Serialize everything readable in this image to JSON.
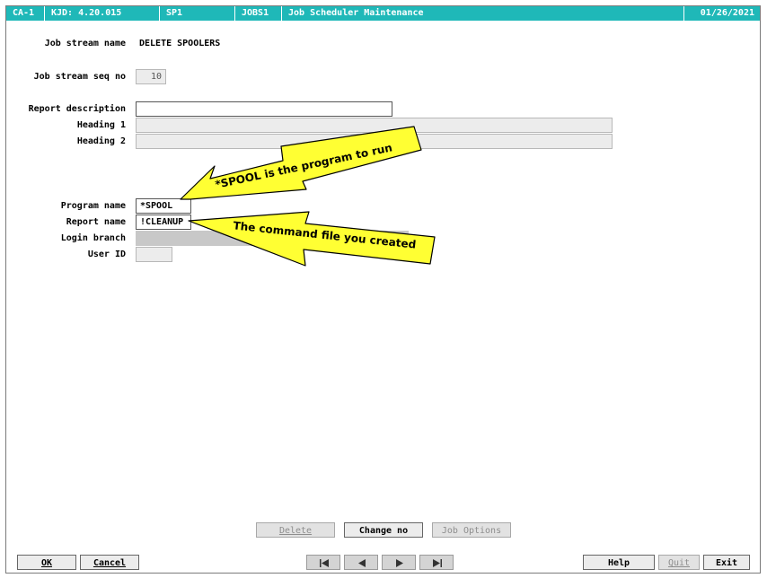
{
  "titlebar": {
    "segments": [
      "CA-1",
      "KJD: 4.20.015",
      "SP1",
      "JOBS1",
      "Job Scheduler Maintenance"
    ],
    "date": "01/26/2021"
  },
  "form": {
    "job_stream_name_label": "Job stream name",
    "job_stream_name_value": "DELETE SPOOLERS",
    "job_stream_seq_label": "Job stream seq no",
    "job_stream_seq_value": "10",
    "report_description_label": "Report description",
    "report_description_value": "",
    "heading1_label": "Heading 1",
    "heading1_value": "",
    "heading2_label": "Heading 2",
    "heading2_value": "",
    "program_name_label": "Program name",
    "program_name_value": "*SPOOL",
    "report_name_label": "Report name",
    "report_name_value": "!CLEANUP",
    "login_branch_label": "Login branch",
    "login_branch_value": "",
    "user_id_label": "User ID",
    "user_id_value": ""
  },
  "callouts": {
    "spool_note": "*SPOOL is the program to run",
    "command_note": "The command file you created",
    "color": "#ffff33"
  },
  "actions": {
    "delete_label": "Delete",
    "change_no_label": "Change no",
    "job_options_label": "Job Options"
  },
  "footer": {
    "ok_label": "OK",
    "cancel_label": "Cancel",
    "help_label": "Help",
    "quit_label": "Quit",
    "exit_label": "Exit",
    "nav_icons": [
      "first-record-icon",
      "previous-record-icon",
      "next-record-icon",
      "last-record-icon"
    ]
  },
  "colors": {
    "titlebar_bg": "#1fb8b8",
    "titlebar_text": "#ffffff"
  }
}
